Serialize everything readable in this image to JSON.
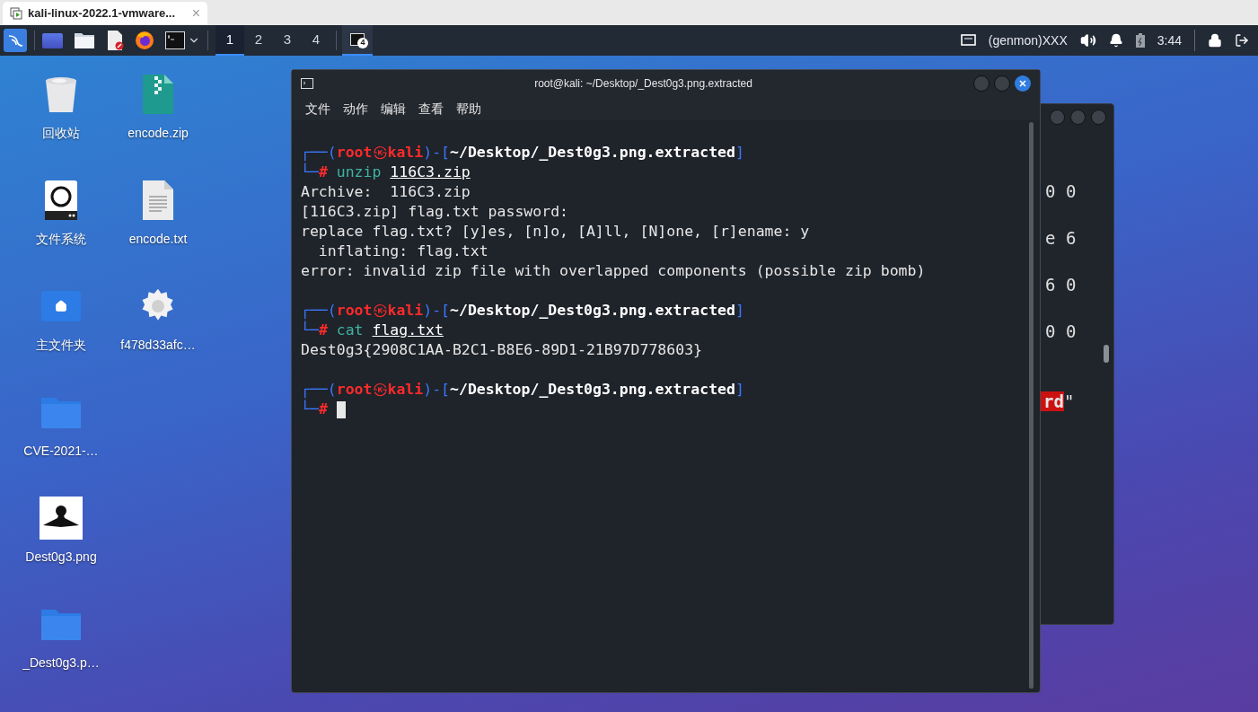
{
  "browser_tab": {
    "title": "kali-linux-2022.1-vmware...",
    "close": "×"
  },
  "taskbar": {
    "workspaces": [
      {
        "label": "1",
        "selected": true
      },
      {
        "label": "2",
        "selected": false
      },
      {
        "label": "3",
        "selected": false
      },
      {
        "label": "4",
        "selected": false
      }
    ],
    "task_badge": "4",
    "genmon": "(genmon)XXX",
    "clock": "3:44"
  },
  "desktop_icons": [
    {
      "label": "回收站",
      "kind": "trash"
    },
    {
      "label": "encode.zip",
      "kind": "zip"
    },
    {
      "label": "文件系统",
      "kind": "drive"
    },
    {
      "label": "encode.txt",
      "kind": "text"
    },
    {
      "label": "主文件夹",
      "kind": "home"
    },
    {
      "label": "f478d33afc…",
      "kind": "gear"
    },
    {
      "label": "CVE-2021-…",
      "kind": "folder"
    },
    {
      "kind": "none"
    },
    {
      "label": "Dest0g3.png"
    },
    {
      "kind": "none"
    },
    {
      "label": "_Dest0g3.p…",
      "kind": "folder"
    }
  ],
  "back_terminal": {
    "lines": [
      {
        "kind": "hex",
        "text": "0 0"
      },
      {
        "kind": "hex",
        "text": "e 6"
      },
      {
        "kind": "hex",
        "text": "6 0"
      },
      {
        "kind": "hex",
        "text": "0 0"
      },
      {
        "kind": "field",
        "highlight": "rd",
        "end": "\""
      }
    ]
  },
  "terminal": {
    "title": "root@kali: ~/Desktop/_Dest0g3.png.extracted",
    "menu": [
      "文件",
      "动作",
      "编辑",
      "查看",
      "帮助"
    ],
    "lines": [
      {
        "kind": "prompt",
        "open": "┌──(",
        "user": "root",
        "sep": "㉿",
        "host": "kali",
        "mid": ")-[",
        "path": "~/Desktop/_Dest0g3.png.extracted",
        "close": "]"
      },
      {
        "kind": "command",
        "lead": "└─",
        "mark": "#",
        "cmd": "unzip",
        "arg": "116C3.zip"
      },
      {
        "kind": "output",
        "text": "Archive:  116C3.zip"
      },
      {
        "kind": "output",
        "text": "[116C3.zip] flag.txt password:"
      },
      {
        "kind": "output",
        "text": "replace flag.txt? [y]es, [n]o, [A]ll, [N]one, [r]ename: y"
      },
      {
        "kind": "output",
        "text": "  inflating: flag.txt"
      },
      {
        "kind": "output",
        "text": "error: invalid zip file with overlapped components (possible zip bomb)"
      },
      {
        "kind": "blank"
      },
      {
        "kind": "prompt",
        "open": "┌──(",
        "user": "root",
        "sep": "㉿",
        "host": "kali",
        "mid": ")-[",
        "path": "~/Desktop/_Dest0g3.png.extracted",
        "close": "]"
      },
      {
        "kind": "command",
        "lead": "└─",
        "mark": "#",
        "cmd": "cat",
        "arg": "flag.txt"
      },
      {
        "kind": "output",
        "text": "Dest0g3{2908C1AA-B2C1-B8E6-89D1-21B97D778603}"
      },
      {
        "kind": "blank"
      },
      {
        "kind": "prompt",
        "open": "┌──(",
        "user": "root",
        "sep": "㉿",
        "host": "kali",
        "mid": ")-[",
        "path": "~/Desktop/_Dest0g3.png.extracted",
        "close": "]"
      },
      {
        "kind": "input",
        "lead": "└─",
        "mark": "#",
        "cursor": true
      }
    ]
  }
}
